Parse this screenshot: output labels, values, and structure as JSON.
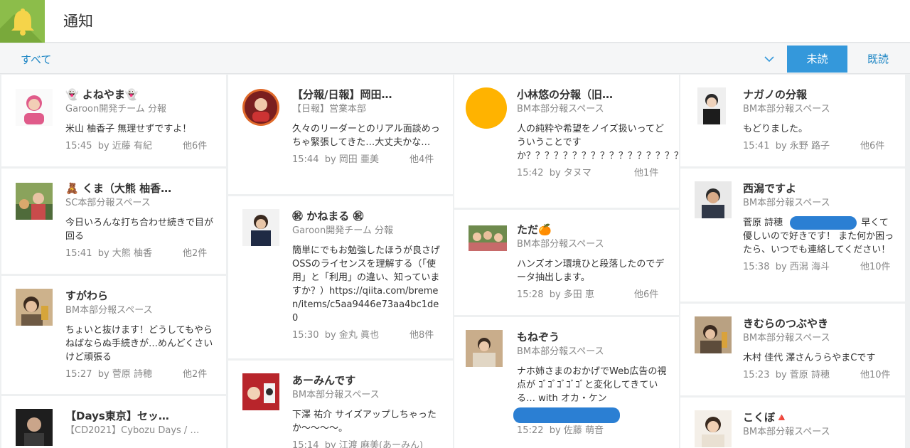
{
  "header": {
    "title": "通知",
    "icon": "bell-icon",
    "accent": "#8cbd4a"
  },
  "filter": {
    "all_label": "すべて",
    "unread_label": "未読",
    "read_label": "既読",
    "active": "unread",
    "active_color": "#3498db"
  },
  "columns": [
    [
      {
        "name": "👻 よねやま👻",
        "space": "Garoon開発チーム 分報",
        "text": "米山 柚香子 無理せずですよ！",
        "time": "15:45",
        "by": "by 近藤 有紀",
        "others": "他6件",
        "avatar": "photo"
      },
      {
        "name": "🧸 くま（大熊 柚香…",
        "space": "SC本部分報スペース",
        "text": "今日いろんな打ち合わせ続きで目が回る",
        "time": "15:41",
        "by": "by 大熊 柚香",
        "others": "他2件",
        "avatar": "photo"
      },
      {
        "name": "すがわら",
        "space": "BM本部分報スペース",
        "text": "ちょいと抜けます！どうしてもやらねばならぬ手続きが…めんどくさいけど頑張る",
        "time": "15:27",
        "by": "by 菅原 詩穂",
        "others": "他2件",
        "avatar": "photo"
      },
      {
        "name": "【Days東京】セッ…",
        "space": "【CD2021】Cybozu Days / …",
        "text": "",
        "time": "",
        "by": "",
        "others": "",
        "avatar": "photo"
      }
    ],
    [
      {
        "name": "【分報/日報】岡田…",
        "space": "【日報】営業本部",
        "text": "久々のリーダーとのリアル面談めっちゃ緊張してきた…大丈夫かな…",
        "time": "15:44",
        "by": "by 岡田 亜美",
        "others": "他4件",
        "avatar": "circle-photo"
      },
      {
        "name": "㊗ かねまる ㊗",
        "space": "Garoon開発チーム 分報",
        "text": "簡単にでもお勉強したほうが良さげ OSSのライセンスを理解する（「使用」と「利用」の違い、知っていますか？）https://qiita.com/bremen/items/c5aa9446e73aa4bc1de0",
        "time": "15:30",
        "by": "by 金丸 眞也",
        "others": "他8件",
        "avatar": "photo"
      },
      {
        "name": "あーみんです",
        "space": "BM本部分報スペース",
        "text": "下澤 祐介 サイズアップしちゃったか〜〜〜〜。",
        "time": "15:14",
        "by": "by 江渡 麻美(あーみん)",
        "others": "",
        "avatar": "photo"
      }
    ],
    [
      {
        "name": "小林悠の分報（旧…",
        "space": "BM本部分報スペース",
        "text": "人の純粋や希望をノイズ扱いってどういうことですか？？？？？？？？？？？？？？？？？？？？？？？？",
        "time": "15:42",
        "by": "by タヌマ",
        "others": "他1件",
        "avatar": "orange-circle"
      },
      {
        "name": "ただ🍊",
        "space": "BM本部分報スペース",
        "text": "ハンズオン環境ひと段落したのでデータ抽出します。",
        "time": "15:28",
        "by": "by 多田 恵",
        "others": "他6件",
        "avatar": "photo"
      },
      {
        "name": "もねぞう",
        "space": "BM本部分報スペース",
        "text": "ナホ姉さまのおかげでWeb広告の視点が ｺﾞｺﾞｺﾞｺﾞｺﾞと変化してきている… with オカ・ケン",
        "time": "15:22",
        "by": "by 佐藤 萌音",
        "others": "",
        "avatar": "photo"
      }
    ],
    [
      {
        "name": "ナガノの分報",
        "space": "BM本部分報スペース",
        "text": "もどりました。",
        "time": "15:41",
        "by": "by 永野 路子",
        "others": "他6件",
        "avatar": "photo"
      },
      {
        "name": "西潟ですよ",
        "space": "BM本部分報スペース",
        "text_pre": "菅原 詩穂 ",
        "text": "早くて優しいので好きです！ また何か困ったら、いつでも連絡してください！",
        "time": "15:38",
        "by": "by 西潟 海斗",
        "others": "他10件",
        "avatar": "photo"
      },
      {
        "name": "きむらのつぶやき",
        "space": "BM本部分報スペース",
        "text": "木村 佳代 澤さんうらやまCです",
        "time": "15:23",
        "by": "by 菅原 詩穂",
        "others": "他10件",
        "avatar": "photo"
      },
      {
        "name": "こくぼ🔺",
        "space": "BM本部分報スペース",
        "text": "",
        "time": "",
        "by": "",
        "others": "",
        "avatar": "photo"
      }
    ]
  ]
}
